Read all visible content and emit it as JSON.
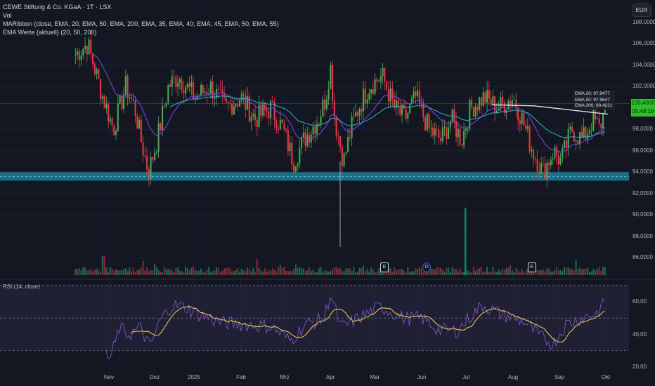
{
  "legend": {
    "title": "CEWE Stiftung & Co. KGaA · 1T · LSX",
    "vol": "Vol",
    "ribbon": "MARibbon (close, EMA, 20, EMA, 50, EMA, 200, EMA, 35, EMA, 40, EMA, 45, EMA, 50, EMA, 55)",
    "ema_values": "EMA Werte (aktuell) (20, 50, 200)"
  },
  "currency": "EUR",
  "price_tag": {
    "price": "100,4000",
    "countdown": "05:48:19"
  },
  "ema_box": [
    "EMA 20:  97.9477",
    "EMA 50:  97.9647",
    "EMA 200: 99.4221"
  ],
  "rsi_label": "RSI (14, close)",
  "colors": {
    "up": "#4caf50",
    "down": "#f23645",
    "band": "#1b7f94",
    "rsi": "#7e57c2",
    "rsi_ma": "#e8c547",
    "ema20": "#7b3fe4",
    "ema50": "#26a9c5",
    "ema200": "#e0e3eb",
    "price_tag": "#2fbd2f"
  },
  "events": [
    {
      "label": "E",
      "date": "2025-05-07"
    },
    {
      "label": "D",
      "date": "2025-06-04"
    },
    {
      "label": "E",
      "date": "2025-08-13"
    }
  ],
  "chart_data": {
    "type": "candlestick",
    "price_axis": {
      "ticks": [
        "108,0000",
        "106,0000",
        "104,0000",
        "102,0000",
        "98,0000",
        "96,0000",
        "94,0000",
        "92,0000",
        "90,0000",
        "88,0000",
        "86,0000"
      ],
      "range": [
        85,
        108.5
      ]
    },
    "x_ticks": [
      "Nov",
      "Dez",
      "2025",
      "Feb",
      "Mrz",
      "Apr",
      "Mai",
      "Jun",
      "Jul",
      "Aug",
      "Sep",
      "Okt"
    ],
    "support_zone": [
      93.2,
      94.0
    ],
    "last_price": 100.4,
    "closes": [
      [
        "2024-10-10",
        105.0
      ],
      [
        "2024-10-18",
        106.0
      ],
      [
        "2024-10-28",
        101.0
      ],
      [
        "2024-11-04",
        98.0
      ],
      [
        "2024-11-12",
        102.0
      ],
      [
        "2024-11-18",
        100.0
      ],
      [
        "2024-11-22",
        97.0
      ],
      [
        "2024-11-27",
        94.0
      ],
      [
        "2024-12-03",
        97.0
      ],
      [
        "2024-12-12",
        102.0
      ],
      [
        "2024-12-20",
        103.0
      ],
      [
        "2025-01-02",
        101.0
      ],
      [
        "2025-01-12",
        102.0
      ],
      [
        "2025-01-22",
        100.0
      ],
      [
        "2025-02-01",
        101.0
      ],
      [
        "2025-02-10",
        99.0
      ],
      [
        "2025-02-20",
        100.0
      ],
      [
        "2025-02-28",
        98.0
      ],
      [
        "2025-03-07",
        95.0
      ],
      [
        "2025-03-14",
        97.0
      ],
      [
        "2025-03-24",
        99.0
      ],
      [
        "2025-03-29",
        101.0
      ],
      [
        "2025-04-01",
        104.0
      ],
      [
        "2025-04-04",
        99.0
      ],
      [
        "2025-04-10",
        95.0
      ],
      [
        "2025-04-15",
        98.0
      ],
      [
        "2025-04-20",
        100.0
      ],
      [
        "2025-04-27",
        102.0
      ],
      [
        "2025-05-06",
        103.0
      ],
      [
        "2025-05-14",
        100.0
      ],
      [
        "2025-05-21",
        99.0
      ],
      [
        "2025-05-28",
        101.0
      ],
      [
        "2025-06-06",
        98.0
      ],
      [
        "2025-06-14",
        97.0
      ],
      [
        "2025-06-21",
        99.0
      ],
      [
        "2025-06-28",
        97.0
      ],
      [
        "2025-07-04",
        100.0
      ],
      [
        "2025-07-13",
        101.0
      ],
      [
        "2025-07-22",
        100.0
      ],
      [
        "2025-08-01",
        101.0
      ],
      [
        "2025-08-07",
        99.0
      ],
      [
        "2025-08-14",
        96.0
      ],
      [
        "2025-08-21",
        94.0
      ],
      [
        "2025-08-28",
        96.0
      ],
      [
        "2025-09-02",
        95.0
      ],
      [
        "2025-09-09",
        98.0
      ],
      [
        "2025-09-16",
        97.0
      ],
      [
        "2025-09-23",
        99.0
      ],
      [
        "2025-09-27",
        98.0
      ],
      [
        "2025-10-01",
        100.4
      ]
    ],
    "rsi": {
      "ticks": [
        "60,00",
        "40,00",
        "20,00"
      ],
      "levels": [
        70,
        50,
        30
      ],
      "values": [
        [
          "2024-10-30",
          28
        ],
        [
          "2024-11-02",
          25
        ],
        [
          "2024-11-08",
          44
        ],
        [
          "2024-11-14",
          40
        ],
        [
          "2024-11-22",
          44
        ],
        [
          "2024-11-28",
          32
        ],
        [
          "2024-12-05",
          48
        ],
        [
          "2024-12-15",
          58
        ],
        [
          "2024-12-25",
          57
        ],
        [
          "2025-01-05",
          52
        ],
        [
          "2025-01-20",
          47
        ],
        [
          "2025-02-05",
          46
        ],
        [
          "2025-02-20",
          45
        ],
        [
          "2025-03-05",
          36
        ],
        [
          "2025-03-15",
          46
        ],
        [
          "2025-03-28",
          50
        ],
        [
          "2025-04-01",
          65
        ],
        [
          "2025-04-08",
          44
        ],
        [
          "2025-04-20",
          50
        ],
        [
          "2025-05-05",
          57
        ],
        [
          "2025-05-20",
          50
        ],
        [
          "2025-06-01",
          50
        ],
        [
          "2025-06-12",
          43
        ],
        [
          "2025-06-25",
          42
        ],
        [
          "2025-07-05",
          52
        ],
        [
          "2025-07-12",
          58
        ],
        [
          "2025-07-25",
          52
        ],
        [
          "2025-08-08",
          48
        ],
        [
          "2025-08-20",
          38
        ],
        [
          "2025-08-28",
          34
        ],
        [
          "2025-09-05",
          46
        ],
        [
          "2025-09-15",
          50
        ],
        [
          "2025-09-25",
          53
        ],
        [
          "2025-10-01",
          60
        ]
      ]
    }
  }
}
